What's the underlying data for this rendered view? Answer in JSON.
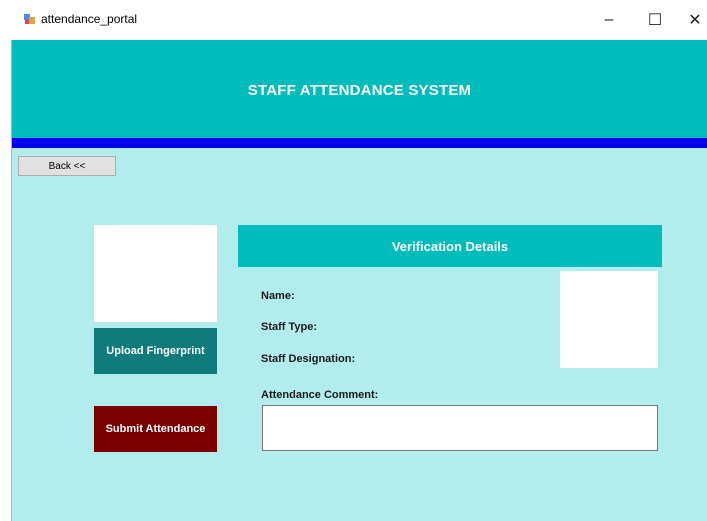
{
  "window": {
    "title": "attendance_portal",
    "controls": {
      "minimize": "–",
      "maximize": "☐",
      "close": "✕"
    }
  },
  "header": {
    "title": "STAFF ATTENDANCE SYSTEM"
  },
  "nav": {
    "back_label": "Back <<"
  },
  "actions": {
    "upload_label": "Upload Fingerprint",
    "submit_label": "Submit Attendance"
  },
  "verification": {
    "title": "Verification Details",
    "name_label": "Name:",
    "staff_type_label": "Staff Type:",
    "staff_designation_label": "Staff Designation:",
    "comment_label": "Attendance Comment:",
    "comment_value": ""
  },
  "colors": {
    "header_bg": "#00bcbc",
    "strip": "#0000ee",
    "content_bg": "#b2eced",
    "upload_bg": "#117b7b",
    "submit_bg": "#7a0000"
  }
}
